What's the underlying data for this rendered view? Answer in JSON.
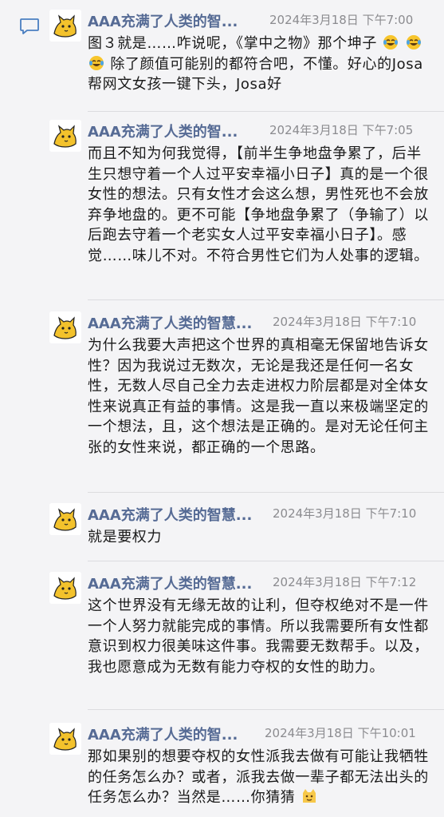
{
  "posts": [
    {
      "author": "AAA充满了人类的智...",
      "time": "2024年3月18日 下午7:00",
      "text_a": "图３就是……咋说呢，《掌中之物》那个坤子",
      "text_b": "除了颜值可能别的都符合吧，不懂。好心的Josa帮网文女孩一键下头，Josa好",
      "emoji_pre": [
        "face-with-tears-of-joy",
        "face-with-tears-of-joy"
      ],
      "emoji_mid": [
        "face-with-tears-of-joy"
      ]
    },
    {
      "author": "AAA充满了人类的智...",
      "time": "2024年3月18日 下午7:05",
      "text": "而且不知为何我觉得，【前半生争地盘争累了，后半生只想守着一个人过平安幸福小日子】真的是一个很女性的想法。只有女性才会这么想，男性死也不会放弃争地盘的。更不可能【争地盘争累了（争输了）以后跑去守着一个老实女人过平安幸福小日子】。感觉……味儿不对。不符合男性它们为人处事的逻辑。"
    },
    {
      "author": "AAA充满了人类的智慧...",
      "time": "2024年3月18日 下午7:10",
      "text": "为什么我要大声把这个世界的真相毫无保留地告诉女性？因为我说过无数次，无论是我还是任何一名女性，无数人尽自己全力去走进权力阶层都是对全体女性来说真正有益的事情。这是我一直以来极端坚定的一个想法，且，这个想法是正确的。是对无论任何主张的女性来说，都正确的一个思路。"
    },
    {
      "author": "AAA充满了人类的智慧...",
      "time": "2024年3月18日 下午7:10",
      "text": "就是要权力"
    },
    {
      "author": "AAA充满了人类的智慧...",
      "time": "2024年3月18日 下午7:12",
      "text": "这个世界没有无缘无故的让利，但夺权绝对不是一件一个人努力就能完成的事情。所以我需要所有女性都意识到权力很美味这件事。我需要无数帮手。以及，我也愿意成为无数有能力夺权的女性的助力。"
    },
    {
      "author": "AAA充满了人类的智...",
      "time": "2024年3月18日 下午10:01",
      "text": "那如果别的想要夺权的女性派我去做有可能让我牺牲的任务怎么办？或者，派我去做一辈子都无法出头的任务怎么办？当然是……你猜猜",
      "emoji_end": [
        "cat-emoji"
      ]
    }
  ],
  "colors": {
    "name": "#566b95",
    "time": "#8b8b8f",
    "text": "#1a1a1a",
    "background": "#f4f4f6",
    "divider": "#dcdcdf",
    "comment_icon": "#4a7fc1"
  },
  "icons": {
    "comment": "comment-icon",
    "avatar": "yellow-cat-avatar"
  }
}
